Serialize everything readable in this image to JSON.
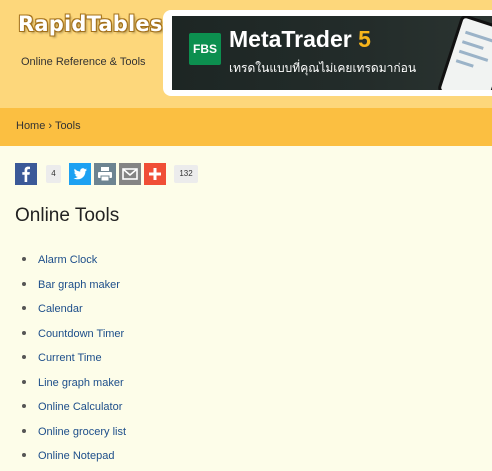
{
  "header": {
    "logo_title": "RapidTables",
    "logo_subtitle": "Online Reference & Tools"
  },
  "ad": {
    "badge": "FBS",
    "title_main": "MetaTrader",
    "title_number": "5",
    "subtitle": "เทรดในแบบที่คุณไม่เคยเทรดมาก่อน"
  },
  "breadcrumb": {
    "home": "Home",
    "separator": "›",
    "current": "Tools"
  },
  "share": {
    "facebook_icon": "facebook-icon",
    "facebook_count": "4",
    "twitter_icon": "twitter-icon",
    "print_icon": "print-icon",
    "email_icon": "email-icon",
    "plus_icon": "plus-icon",
    "total_count": "132",
    "colors": {
      "facebook": "#3b5998",
      "twitter": "#1da1f2",
      "print": "#6d8491",
      "email": "#848484",
      "plus": "#f04e36"
    }
  },
  "main": {
    "title": "Online Tools",
    "tools": [
      {
        "label": "Alarm Clock"
      },
      {
        "label": "Bar graph maker"
      },
      {
        "label": "Calendar"
      },
      {
        "label": "Countdown Timer"
      },
      {
        "label": "Current Time"
      },
      {
        "label": "Line graph maker"
      },
      {
        "label": "Online Calculator"
      },
      {
        "label": "Online grocery list"
      },
      {
        "label": "Online Notepad"
      }
    ]
  }
}
